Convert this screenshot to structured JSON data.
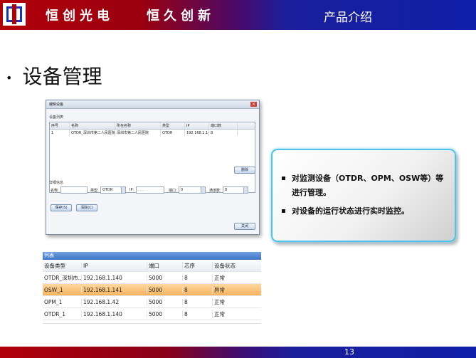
{
  "header": {
    "slogan_left": "恒创光电",
    "slogan_right": "恒久创新",
    "title": "产品介绍"
  },
  "bullet": {
    "text": "设备管理"
  },
  "dialog": {
    "title": "编辑设备",
    "list_group": "设备列表",
    "columns": [
      "序号",
      "名称",
      "所在名称",
      "类型",
      "IP",
      "端口数"
    ],
    "row": [
      "1",
      "OTDR_深圳市第二人民医院",
      "深圳市第二人民医院",
      "OTDR",
      "192.168.1.140",
      "8"
    ],
    "delete_button": "删除",
    "detail_group": "详细信息",
    "name_label": "名称:",
    "type_label": "类型:",
    "type_value": "OTDR",
    "ip_label": "IP:",
    "ip_value": ". . .",
    "port_label": "端口:",
    "port_value": "0",
    "channels_label": "通道数:",
    "channels_value": "8",
    "save_button": "保存(S)",
    "clear_button": "清除(C)",
    "close_button": "关闭"
  },
  "callout": {
    "items": [
      "对监测设备（OTDR、OPM、OSW等）等进行管理。",
      "对设备的运行状态进行实时监控。"
    ]
  },
  "grid": {
    "caption": "列表",
    "headers": [
      "设备类型",
      "IP",
      "端口",
      "芯序",
      "设备状态"
    ],
    "rows": [
      [
        "OTDR_深圳市...",
        "192.168.1.140",
        "5000",
        "8",
        "正常"
      ],
      [
        "OSW_1",
        "192.168.1.141",
        "5000",
        "8",
        "异常"
      ],
      [
        "OPM_1",
        "192.168.1.42",
        "5000",
        "8",
        "正常"
      ],
      [
        "OTDR_1",
        "192.168.1.140",
        "5000",
        "8",
        "正常"
      ]
    ]
  },
  "footer": {
    "page": "13"
  }
}
